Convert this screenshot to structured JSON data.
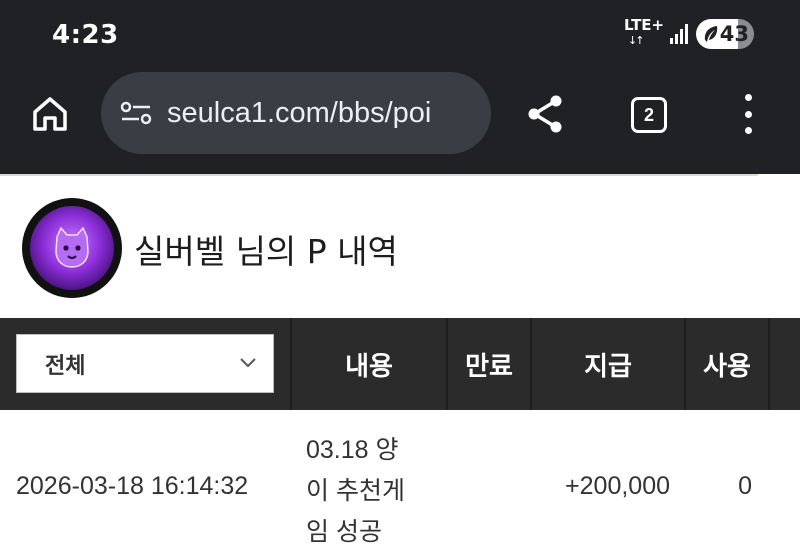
{
  "status_bar": {
    "time": "4:23",
    "network": "LTE+",
    "network_arrows": "↓↑",
    "battery": "43"
  },
  "browser": {
    "url": "seulca1.com/bbs/poi",
    "tab_count": "2"
  },
  "profile": {
    "title": "실버벨 님의 P 내역"
  },
  "table": {
    "filter": {
      "selected": "전체"
    },
    "columns": [
      "내용",
      "만료",
      "지급",
      "사용"
    ],
    "rows": [
      {
        "datetime": "2026-03-18 16:14:32",
        "content_lines": [
          "03.18 양",
          "이 추천게",
          "임 성공"
        ],
        "expire": "",
        "pay": "+200,000",
        "use": "0"
      }
    ]
  },
  "colors": {
    "dark_bar": "#1f2124",
    "url_pill": "#3a3d44",
    "table_header": "#2b2b2b",
    "avatar_accent": "#8c2fd9"
  }
}
